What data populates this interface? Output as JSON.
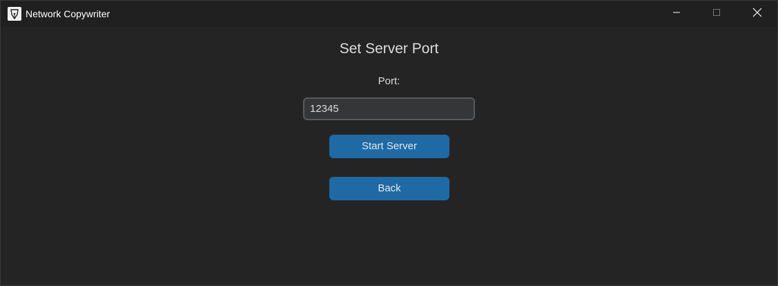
{
  "window": {
    "title": "Network Copywriter",
    "icon": "fountain-pen-nib-icon",
    "controls": [
      "minimize-icon",
      "maximize-icon",
      "close-icon"
    ]
  },
  "main": {
    "heading": "Set Server Port",
    "port_label": "Port:",
    "port_value": "12345",
    "start_button_label": "Start Server",
    "back_button_label": "Back"
  },
  "colors": {
    "background": "#242424",
    "titlebar": "#202020",
    "accent": "#1f6aa5",
    "input_bg": "#343638",
    "input_border": "#565b5e",
    "text": "#dcdcdc"
  }
}
